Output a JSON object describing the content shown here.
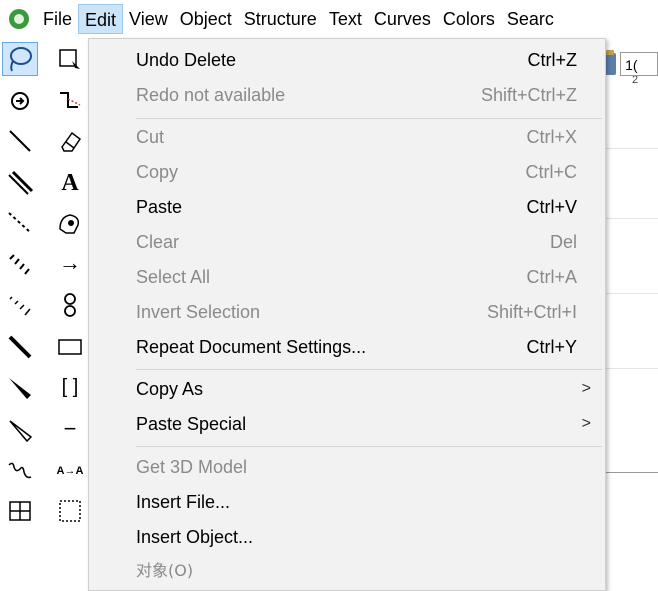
{
  "menubar": {
    "items": [
      {
        "label": "File"
      },
      {
        "label": "Edit",
        "active": true
      },
      {
        "label": "View"
      },
      {
        "label": "Object"
      },
      {
        "label": "Structure"
      },
      {
        "label": "Text"
      },
      {
        "label": "Curves"
      },
      {
        "label": "Colors"
      },
      {
        "label": "Searc"
      }
    ]
  },
  "toolbar": {
    "zoom_value": "1("
  },
  "ruler": {
    "tick": "2"
  },
  "edit_menu": {
    "items": [
      {
        "label": "Undo Delete",
        "shortcut": "Ctrl+Z",
        "enabled": true
      },
      {
        "label": "Redo not available",
        "shortcut": "Shift+Ctrl+Z",
        "enabled": false
      },
      {
        "label": "Cut",
        "shortcut": "Ctrl+X",
        "enabled": false
      },
      {
        "label": "Copy",
        "shortcut": "Ctrl+C",
        "enabled": false
      },
      {
        "label": "Paste",
        "shortcut": "Ctrl+V",
        "enabled": true
      },
      {
        "label": "Clear",
        "shortcut": "Del",
        "enabled": false
      },
      {
        "label": "Select All",
        "shortcut": "Ctrl+A",
        "enabled": false
      },
      {
        "label": "Invert Selection",
        "shortcut": "Shift+Ctrl+I",
        "enabled": false
      },
      {
        "label": "Repeat Document Settings...",
        "shortcut": "Ctrl+Y",
        "enabled": true
      },
      {
        "label": "Copy As",
        "submenu_arrow": ">",
        "enabled": true
      },
      {
        "label": "Paste Special",
        "submenu_arrow": ">",
        "enabled": true
      },
      {
        "label": "Get 3D Model",
        "enabled": false
      },
      {
        "label": "Insert File...",
        "enabled": true
      },
      {
        "label": "Insert Object...",
        "enabled": true
      },
      {
        "label": "对象(O)",
        "enabled": false
      }
    ]
  },
  "tools": {
    "text_tool_glyph": "A",
    "bracket_glyph": "[ ]",
    "dash_glyph": "−",
    "arrow_glyph": "→",
    "text_arrow_glyph": "A→A"
  }
}
